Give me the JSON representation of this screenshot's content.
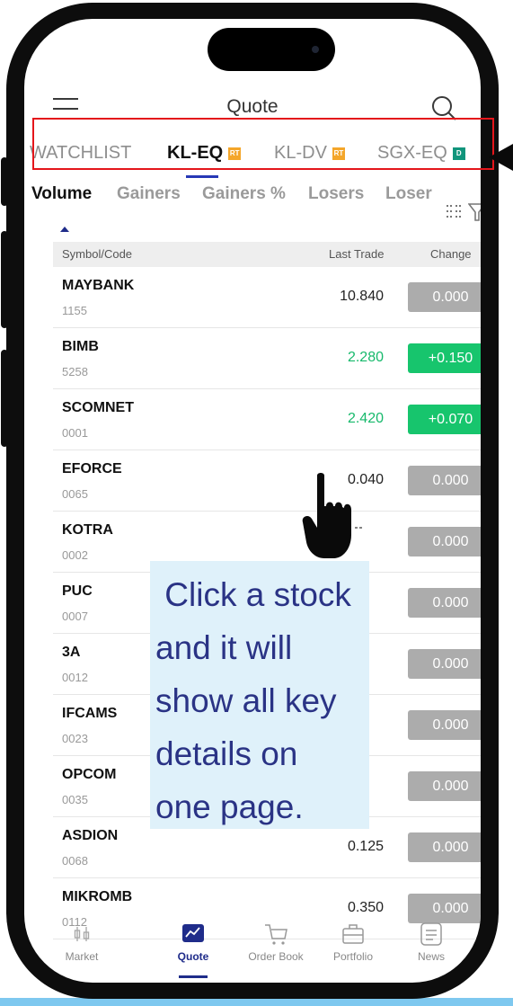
{
  "header": {
    "title": "Quote"
  },
  "market_tabs": [
    {
      "label": "WATCHLIST",
      "badge": ""
    },
    {
      "label": "KL-EQ",
      "badge": "RT"
    },
    {
      "label": "KL-DV",
      "badge": "RT"
    },
    {
      "label": "SGX-EQ",
      "badge": "D"
    }
  ],
  "sort_tabs": [
    "Volume",
    "Gainers",
    "Gainers %",
    "Losers",
    "Loser"
  ],
  "table": {
    "headers": {
      "symbol": "Symbol/Code",
      "last": "Last Trade",
      "change": "Change"
    },
    "rows": [
      {
        "name": "MAYBANK",
        "code": "1155",
        "last": "10.840",
        "change": "0.000",
        "trend": "flat"
      },
      {
        "name": "BIMB",
        "code": "5258",
        "last": "2.280",
        "change": "+0.150",
        "trend": "up"
      },
      {
        "name": "SCOMNET",
        "code": "0001",
        "last": "2.420",
        "change": "+0.070",
        "trend": "up"
      },
      {
        "name": "EFORCE",
        "code": "0065",
        "last": "0.040",
        "change": "0.000",
        "trend": "flat"
      },
      {
        "name": "KOTRA",
        "code": "0002",
        "last": "",
        "change": "0.000",
        "trend": "flat"
      },
      {
        "name": "PUC",
        "code": "0007",
        "last": "",
        "change": "0.000",
        "trend": "flat"
      },
      {
        "name": "3A",
        "code": "0012",
        "last": "",
        "change": "0.000",
        "trend": "flat"
      },
      {
        "name": "IFCAMS",
        "code": "0023",
        "last": "",
        "change": "0.000",
        "trend": "flat"
      },
      {
        "name": "OPCOM",
        "code": "0035",
        "last": "",
        "change": "0.000",
        "trend": "flat"
      },
      {
        "name": "ASDION",
        "code": "0068",
        "last": "0.125",
        "change": "0.000",
        "trend": "flat"
      },
      {
        "name": "MIKROMB",
        "code": "0112",
        "last": "0.350",
        "change": "0.000",
        "trend": "flat"
      }
    ]
  },
  "callout": {
    "lines": [
      " Click a stock",
      "and it will",
      "show all key",
      "details on",
      "one page."
    ]
  },
  "bottom_nav": [
    {
      "label": "Market",
      "icon": "market-icon"
    },
    {
      "label": "Quote",
      "icon": "chart-icon"
    },
    {
      "label": "Order Book",
      "icon": "cart-icon"
    },
    {
      "label": "Portfolio",
      "icon": "portfolio-icon"
    },
    {
      "label": "News",
      "icon": "news-icon"
    }
  ],
  "colors": {
    "accent": "#1f2c8a",
    "up": "#17c56d",
    "flat": "#acacac",
    "highlight": "#e4161b",
    "badge_rt": "#f4a62a",
    "badge_d": "#11957c"
  }
}
